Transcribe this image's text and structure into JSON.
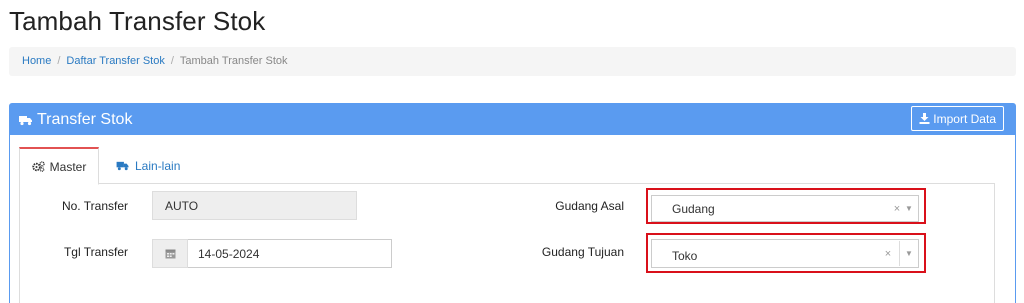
{
  "page": {
    "title": "Tambah Transfer Stok"
  },
  "breadcrumb": {
    "home": "Home",
    "separator": "/",
    "list": "Daftar Transfer Stok",
    "current": "Tambah Transfer Stok"
  },
  "panel": {
    "title": "Transfer Stok",
    "title_icon": "truck-icon",
    "import_label": "Import Data",
    "import_icon": "download-icon",
    "accent": "#5a9bf0"
  },
  "tabs": [
    {
      "label": "Master",
      "icon": "cogs-icon",
      "active": true
    },
    {
      "label": "Lain-lain",
      "icon": "truck-icon",
      "active": false
    }
  ],
  "form": {
    "no_transfer": {
      "label": "No. Transfer",
      "value": "AUTO"
    },
    "tgl_transfer": {
      "label": "Tgl Transfer",
      "value": "14-05-2024",
      "icon": "calendar-icon"
    },
    "gudang_asal": {
      "label": "Gudang Asal",
      "value": "Gudang",
      "clear": "×",
      "arrow": "▼"
    },
    "gudang_tujuan": {
      "label": "Gudang Tujuan",
      "value": "Toko",
      "clear": "×",
      "arrow": "▼"
    }
  },
  "colors": {
    "highlight": "#d9101a",
    "link": "#2a7ac2",
    "active_tab_border": "#e25252"
  }
}
